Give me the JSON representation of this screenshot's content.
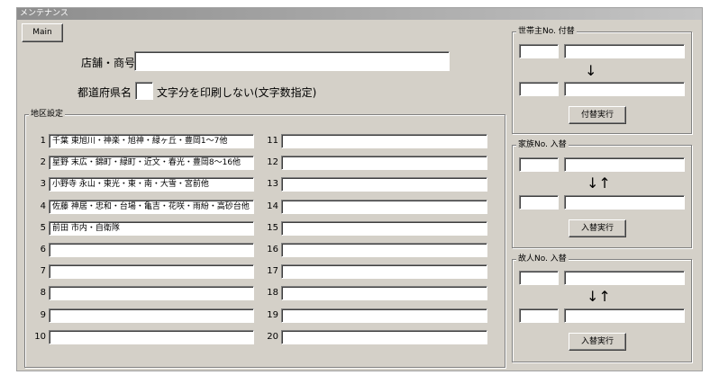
{
  "window": {
    "title": "メンテナンス"
  },
  "main_button": "Main",
  "store": {
    "label": "店舗・商号",
    "value": ""
  },
  "prefecture": {
    "label": "都道府県名",
    "value": "",
    "suffix": "文字分を印刷しない(文字数指定)"
  },
  "area": {
    "title": "地区設定",
    "rows_left": [
      {
        "num": "1",
        "value": "千葉  東旭川・神楽・旭神・緑ヶ丘・豊岡1〜7他"
      },
      {
        "num": "2",
        "value": "星野  末広・錦町・緑町・近文・春光・豊岡8〜16他"
      },
      {
        "num": "3",
        "value": "小野寺  永山・東光・東・南・大雪・宮前他"
      },
      {
        "num": "4",
        "value": "佐藤  神居・忠和・台場・亀吉・花咲・雨紛・高砂台他"
      },
      {
        "num": "5",
        "value": "前田  市内・自衛隊"
      },
      {
        "num": "6",
        "value": ""
      },
      {
        "num": "7",
        "value": ""
      },
      {
        "num": "8",
        "value": ""
      },
      {
        "num": "9",
        "value": ""
      },
      {
        "num": "10",
        "value": ""
      }
    ],
    "rows_right": [
      {
        "num": "11",
        "value": ""
      },
      {
        "num": "12",
        "value": ""
      },
      {
        "num": "13",
        "value": ""
      },
      {
        "num": "14",
        "value": ""
      },
      {
        "num": "15",
        "value": ""
      },
      {
        "num": "16",
        "value": ""
      },
      {
        "num": "17",
        "value": ""
      },
      {
        "num": "18",
        "value": ""
      },
      {
        "num": "19",
        "value": ""
      },
      {
        "num": "20",
        "value": ""
      }
    ]
  },
  "householder": {
    "title": "世帯主No. 付替",
    "arrow": "↓",
    "button": "付替実行"
  },
  "family": {
    "title": "家族No. 入替",
    "arrow": "↓↑",
    "button": "入替実行"
  },
  "deceased": {
    "title": "故人No. 入替",
    "arrow": "↓↑",
    "button": "入替実行"
  }
}
